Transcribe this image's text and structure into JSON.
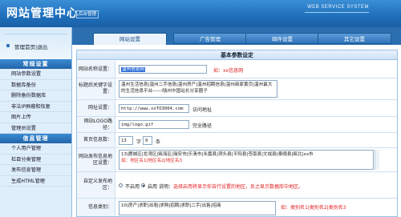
{
  "header": {
    "title": "网站管理中心",
    "subtitle": "后台管理",
    "brand": "WEB SERVICE SYSTEM"
  },
  "tabs": [
    {
      "label": "网站设置",
      "active": true
    },
    {
      "label": "广告管理",
      "active": false
    },
    {
      "label": "邮件设置",
      "active": false
    },
    {
      "label": "其它设置",
      "active": false
    }
  ],
  "sidebar": {
    "top_link": "管理首页|退出",
    "sections": [
      {
        "title": "常规设置",
        "items": [
          "网站参数设置",
          "数据库备份",
          "删除备份数据库",
          "非法IP屏蔽和恢复",
          "图片上传",
          "管理员设置"
        ]
      },
      {
        "title": "信息管理",
        "items": [
          "个人用户管理",
          "栏目分类管理",
          "发布信息管理",
          "生成HTML管理"
        ]
      }
    ]
  },
  "panel": {
    "title": "基本参数设定",
    "fields": {
      "site_name": {
        "label": "网站名称设置：",
        "value": "温州信息网",
        "hint": "如：xx信息网"
      },
      "keywords": {
        "label": "标题后关键字设置：",
        "value": "温州生活信息|温州二手信息|温州房产|温州招聘信息|温州商家黄页|温州最大的生活信息平台——l钱州中国站长分享圈子"
      },
      "site_url": {
        "label": "网址设置：",
        "value": "http://www.xxTO3004.com",
        "hint": "访问地址"
      },
      "logo": {
        "label": "网站LOGO路径：",
        "value": "img/logo.gif",
        "hint": "完全路径"
      },
      "page_size": {
        "label": "首页信息数：",
        "value": "13",
        "unit_a": "字",
        "count": "9",
        "unit_b": "条"
      },
      "regions": {
        "label": "网站发布信息地区设置：",
        "value": "13|鹿城区|龙湾区|瓯海区|瑞安市|乐清市|永嘉县|洞头县|平阳县|苍南县|文成县|泰顺县|瓯北|xx市",
        "hint": "如：地区名1|地区名2|地区名3"
      },
      "custom_region": {
        "label": "自定义发布地区：",
        "option_off": "不启用",
        "option_on": "启用",
        "selected": "启用",
        "desc_prefix": "说明：",
        "desc": "选择启用将显示你自行设置的地区，反之显示数据库中地区。"
      },
      "categories": {
        "label": "信息类别：",
        "value": "10|房产|求职|出租|求购|招聘|求职|二手|出售|招商",
        "hint": "如：类别名1|类别名2|类别名3"
      }
    }
  }
}
